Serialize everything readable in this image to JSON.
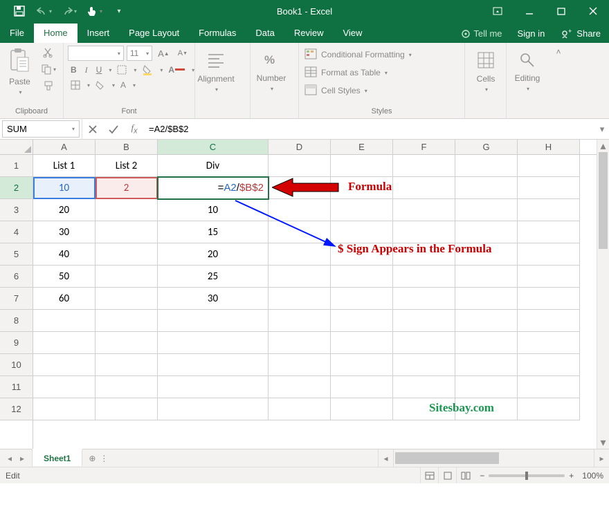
{
  "titlebar": {
    "title": "Book1 - Excel"
  },
  "tabs": {
    "file": "File",
    "home": "Home",
    "insert": "Insert",
    "pageLayout": "Page Layout",
    "formulas": "Formulas",
    "data": "Data",
    "review": "Review",
    "view": "View",
    "tellme": "Tell me",
    "signin": "Sign in",
    "share": "Share"
  },
  "ribbon": {
    "clipboard": {
      "paste": "Paste",
      "label": "Clipboard"
    },
    "font": {
      "name": "",
      "size": "11",
      "label": "Font"
    },
    "alignment": {
      "label": "Alignment"
    },
    "number": {
      "label": "Number"
    },
    "styles": {
      "cond": "Conditional Formatting",
      "table": "Format as Table",
      "cell": "Cell Styles",
      "label": "Styles"
    },
    "cells": {
      "label": "Cells"
    },
    "editing": {
      "label": "Editing"
    }
  },
  "fbar": {
    "name": "SUM",
    "formula": "=A2/$B$2"
  },
  "grid": {
    "cols": [
      "A",
      "B",
      "C",
      "D",
      "E",
      "F",
      "G",
      "H"
    ],
    "rows": [
      "1",
      "2",
      "3",
      "4",
      "5",
      "6",
      "7",
      "8",
      "9",
      "10",
      "11",
      "12"
    ],
    "headers": {
      "a": "List 1",
      "b": "List 2",
      "c": "Div"
    },
    "data": {
      "a": [
        "10",
        "20",
        "30",
        "40",
        "50",
        "60"
      ],
      "b": [
        "2"
      ],
      "c": [
        "=A2/$B$2",
        "10",
        "15",
        "20",
        "25",
        "30"
      ]
    },
    "c2parts": {
      "p1": "=",
      "p2": "A2",
      "p3": "/",
      "p4": "$B$2"
    }
  },
  "anno": {
    "formula": "Formula",
    "dollar": "$ Sign Appears in the Formula",
    "site": "Sitesbay.com"
  },
  "sheets": {
    "s1": "Sheet1"
  },
  "status": {
    "mode": "Edit",
    "zoom": "100%"
  }
}
